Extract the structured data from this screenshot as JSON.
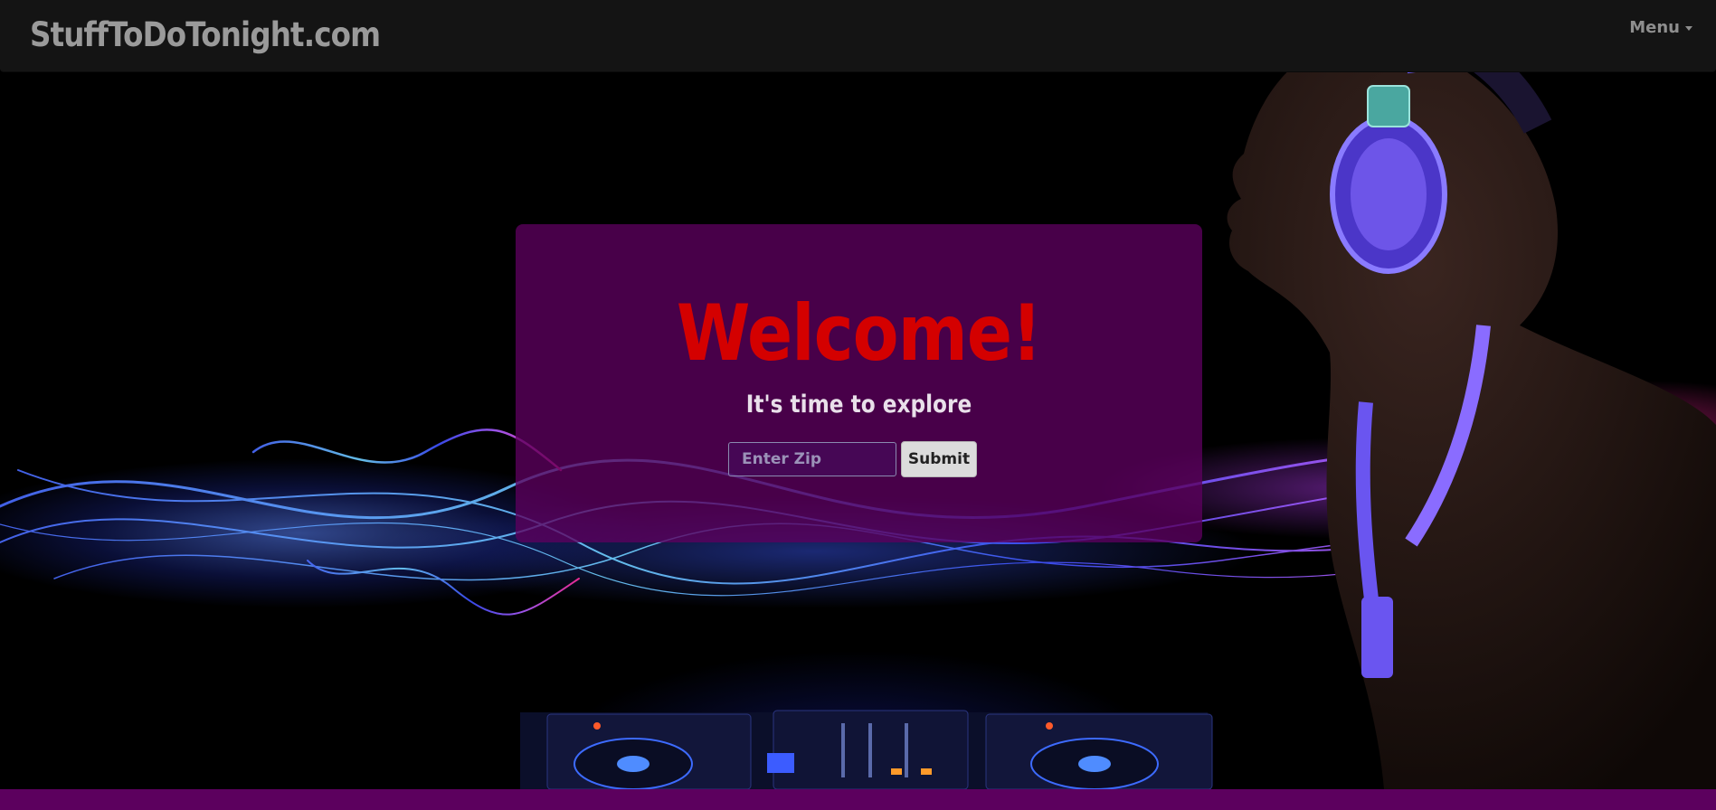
{
  "brand": {
    "name": "StuffToDoTonight.com"
  },
  "nav": {
    "menu_label": "Menu"
  },
  "welcome": {
    "title": "Welcome!",
    "subtitle": "It's time to explore",
    "zip_placeholder": "Enter Zip",
    "submit_label": "Submit"
  },
  "colors": {
    "navbar": "#141414",
    "panel": "#5c005e",
    "title": "#d40000",
    "footer": "#5c005e"
  },
  "icons": {
    "menu_caret": "chevron-down-icon"
  }
}
